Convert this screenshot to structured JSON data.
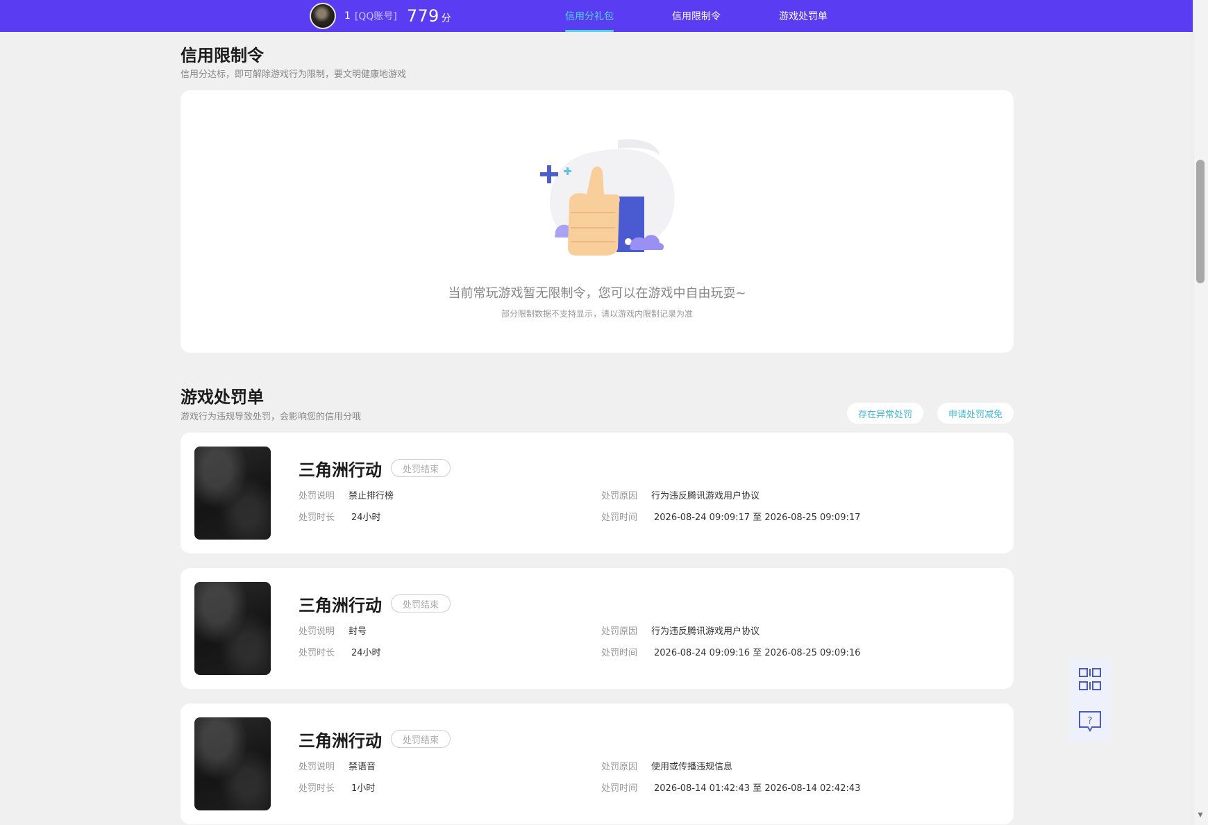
{
  "header": {
    "user_id": "1",
    "account_type": "[QQ账号]",
    "score": "779",
    "score_unit": "分",
    "tabs": [
      {
        "label": "信用分礼包",
        "active": true
      },
      {
        "label": "信用限制令",
        "active": false
      },
      {
        "label": "游戏处罚单",
        "active": false
      }
    ]
  },
  "restriction": {
    "title": "信用限制令",
    "subtitle": "信用分达标，即可解除游戏行为限制，要文明健康地游戏",
    "empty_message": "当前常玩游戏暂无限制令，您可以在游戏中自由玩耍~",
    "empty_note": "部分限制数据不支持显示，请以游戏内限制记录为准",
    "illustration_icon": "thumbs-up-illustration"
  },
  "penalties": {
    "title": "游戏处罚单",
    "subtitle": "游戏行为违规导致处罚，会影响您的信用分哦",
    "actions": {
      "dispute": "存在异常处罚",
      "reduce": "申请处罚减免"
    },
    "labels": {
      "description": "处罚说明",
      "duration": "处罚时长",
      "reason": "处罚原因",
      "time": "处罚时间"
    },
    "items": [
      {
        "game": "三角洲行动",
        "status": "处罚结束",
        "description": "禁止排行榜",
        "duration": "24小时",
        "reason": "行为违反腾讯游戏用户协议",
        "time": "2026-08-24 09:09:17 至 2026-08-25 09:09:17"
      },
      {
        "game": "三角洲行动",
        "status": "处罚结束",
        "description": "封号",
        "duration": "24小时",
        "reason": "行为违反腾讯游戏用户协议",
        "time": "2026-08-24 09:09:16 至 2026-08-25 09:09:16"
      },
      {
        "game": "三角洲行动",
        "status": "处罚结束",
        "description": "禁语音",
        "duration": "1小时",
        "reason": "使用或传播违规信息",
        "time": "2026-08-14 01:42:43 至 2026-08-14 02:42:43"
      }
    ]
  },
  "floating_tools": [
    {
      "icon": "qr-code-icon"
    },
    {
      "icon": "help-chat-icon"
    }
  ],
  "colors": {
    "topbar": "#5a3cf2",
    "active_tab": "#4fd7ef",
    "pill_text": "#3fb8d8",
    "page_bg": "#f0f0f0"
  }
}
